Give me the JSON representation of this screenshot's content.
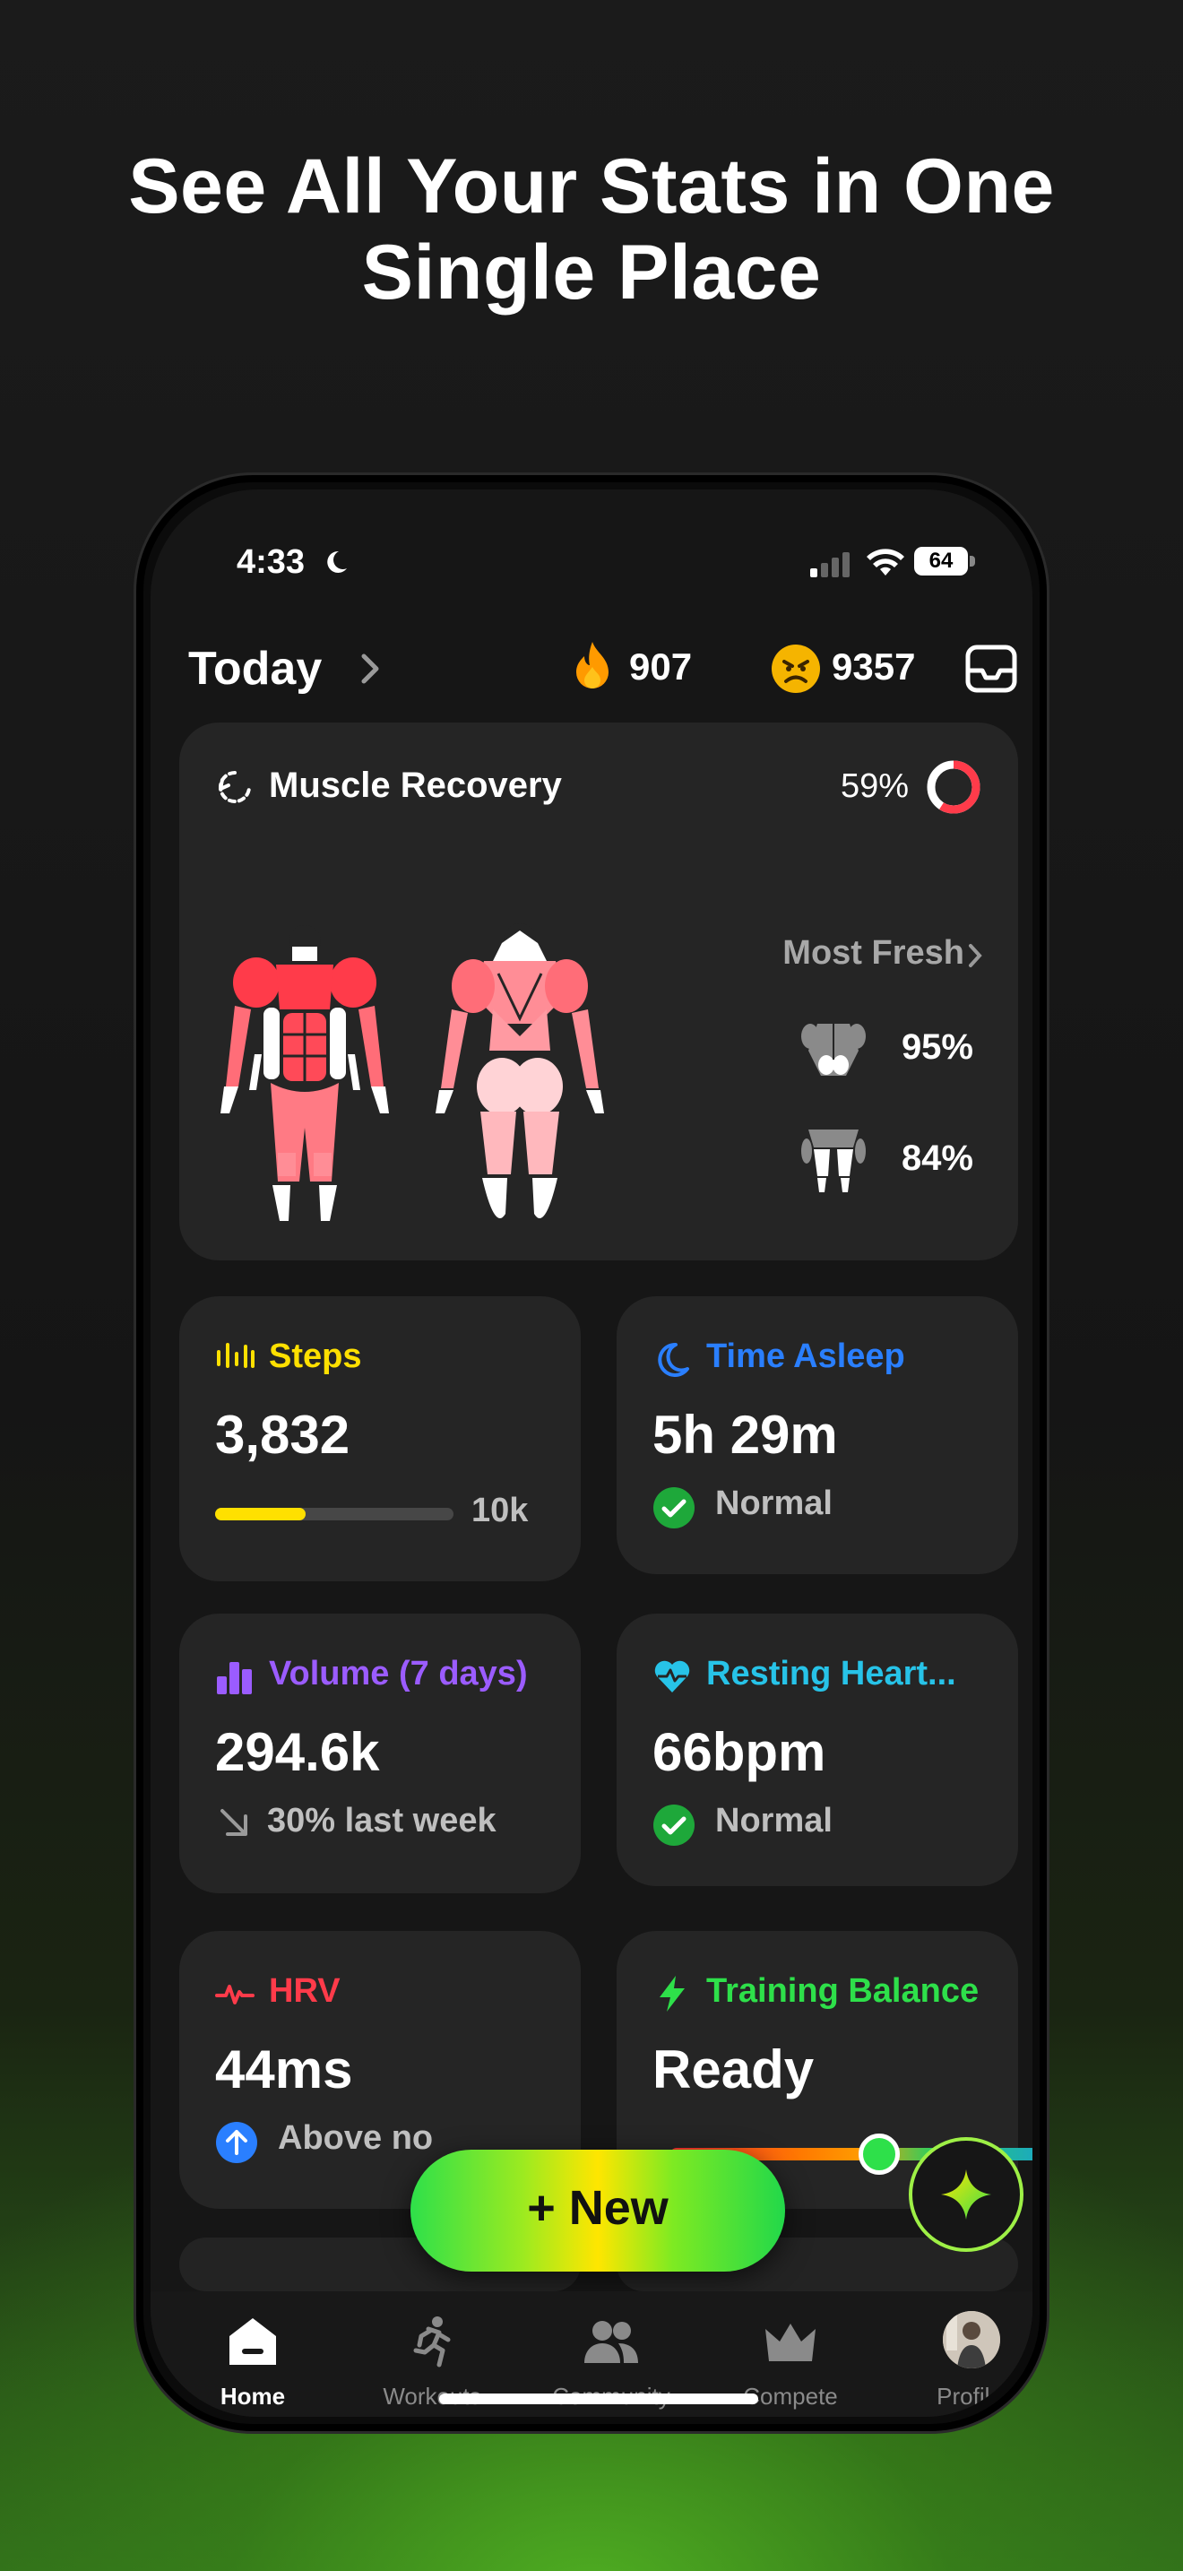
{
  "headline": {
    "line1": "See All Your Stats in One",
    "line2": "Single Place"
  },
  "status_bar": {
    "time": "4:33",
    "battery": "64"
  },
  "header": {
    "title": "Today",
    "streak": "907",
    "points": "9357"
  },
  "muscle_recovery": {
    "title": "Muscle Recovery",
    "percent": "59%",
    "percent_value": 0.59,
    "most_fresh_label": "Most Fresh",
    "fresh_items": [
      {
        "icon": "back-muscles-icon",
        "percent": "95%"
      },
      {
        "icon": "legs-muscles-icon",
        "percent": "84%"
      }
    ]
  },
  "cards": {
    "steps": {
      "title": "Steps",
      "value": "3,832",
      "goal": "10k",
      "progress": 0.38,
      "color": "#ffe000"
    },
    "sleep": {
      "title": "Time Asleep",
      "value": "5h 29m",
      "status": "Normal",
      "color": "#2a7fff"
    },
    "volume": {
      "title": "Volume (7 days)",
      "value": "294.6k",
      "trend": "30% last week",
      "color": "#9b5cff"
    },
    "heart": {
      "title": "Resting Heart...",
      "value": "66bpm",
      "status": "Normal",
      "color": "#27c3e8"
    },
    "hrv": {
      "title": "HRV",
      "value": "44ms",
      "status": "Above no",
      "color": "#ff3b4a"
    },
    "training": {
      "title": "Training Balance",
      "value": "Ready",
      "color": "#2ee04a"
    }
  },
  "new_button": {
    "label": "New"
  },
  "tabs": [
    {
      "label": "Home",
      "icon": "home-icon",
      "active": true
    },
    {
      "label": "Workouts",
      "icon": "runner-icon",
      "active": false
    },
    {
      "label": "Community",
      "icon": "people-icon",
      "active": false
    },
    {
      "label": "Compete",
      "icon": "crown-icon",
      "active": false
    },
    {
      "label": "Profile",
      "icon": "avatar",
      "active": false
    }
  ]
}
